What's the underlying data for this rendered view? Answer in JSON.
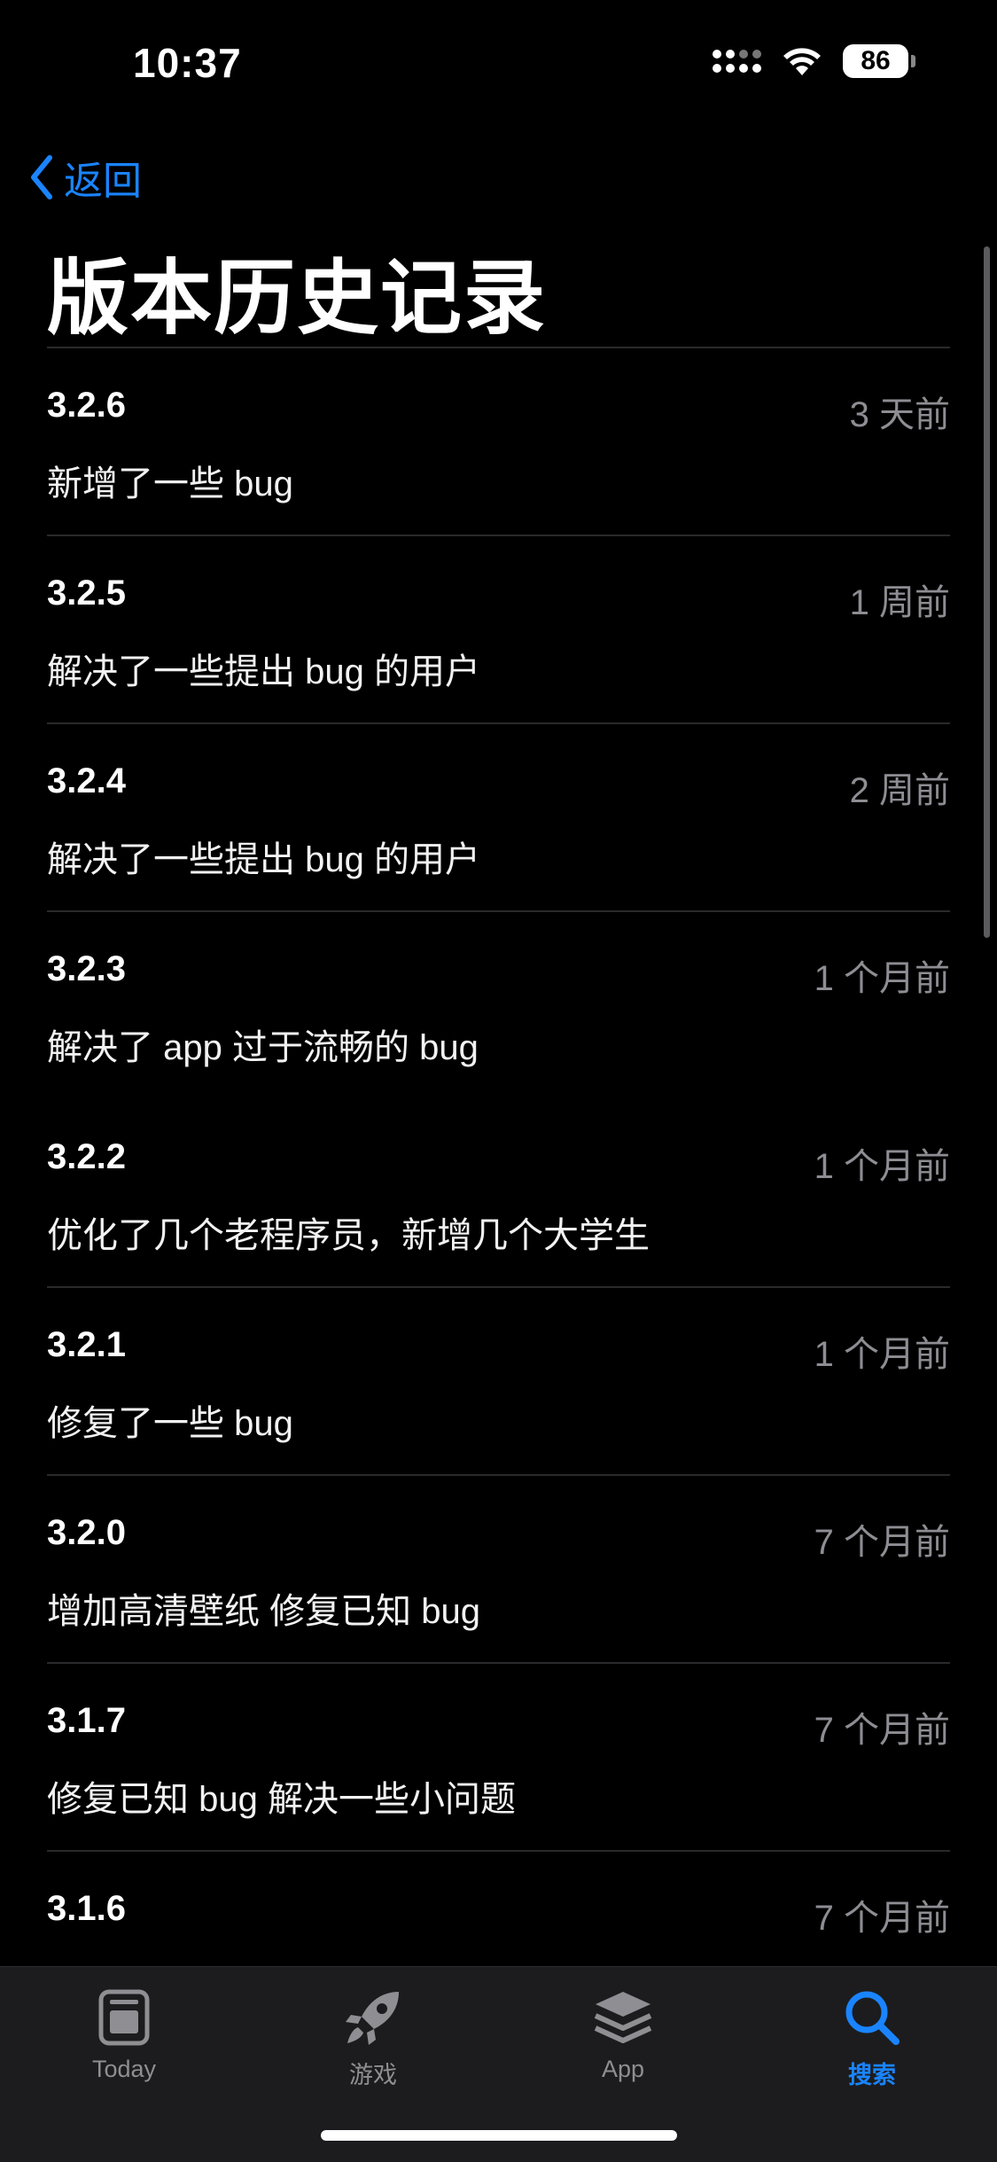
{
  "status_bar": {
    "time": "10:37",
    "battery": "86"
  },
  "nav": {
    "back_label": "返回",
    "title": "版本历史记录"
  },
  "versions": [
    {
      "version": "3.2.6",
      "date": "3 天前",
      "notes": "新增了一些 bug"
    },
    {
      "version": "3.2.5",
      "date": "1 周前",
      "notes": "解决了一些提出 bug 的用户"
    },
    {
      "version": "3.2.4",
      "date": "2 周前",
      "notes": "解决了一些提出 bug 的用户"
    },
    {
      "version": "3.2.3",
      "date": "1 个月前",
      "notes": "解决了 app 过于流畅的 bug"
    },
    {
      "version": "3.2.2",
      "date": "1 个月前",
      "notes": "优化了几个老程序员，新增几个大学生"
    },
    {
      "version": "3.2.1",
      "date": "1 个月前",
      "notes": "修复了一些 bug"
    },
    {
      "version": "3.2.0",
      "date": "7 个月前",
      "notes": "增加高清壁纸 修复已知 bug"
    },
    {
      "version": "3.1.7",
      "date": "7 个月前",
      "notes": "修复已知 bug 解决一些小问题"
    },
    {
      "version": "3.1.6",
      "date": "7 个月前",
      "notes": ""
    }
  ],
  "tab_bar": {
    "tabs": [
      {
        "label": "Today",
        "icon": "today-icon",
        "active": false
      },
      {
        "label": "游戏",
        "icon": "rocket-icon",
        "active": false
      },
      {
        "label": "App",
        "icon": "app-stack-icon",
        "active": false
      },
      {
        "label": "搜索",
        "icon": "search-icon",
        "active": true
      }
    ]
  },
  "colors": {
    "accent": "#1a84ff",
    "background": "#000000",
    "secondary_text": "#8d8d93",
    "tab_bar": "#1c1c1e"
  }
}
